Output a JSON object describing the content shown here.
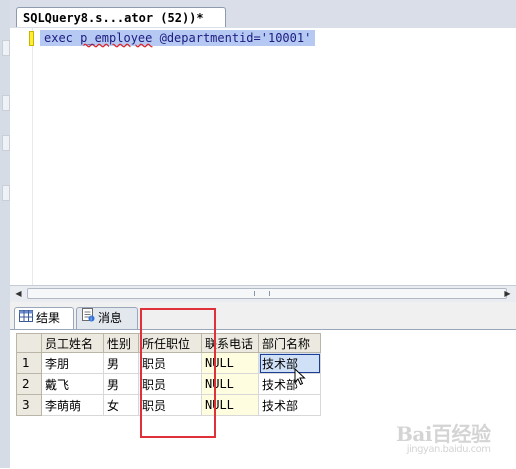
{
  "editor_tab": {
    "title": "SQLQuery8.s...ator (52))*"
  },
  "editor": {
    "code_prefix": "exec ",
    "code_proc": "p_employee",
    "code_suffix": " @departmentid='10001'"
  },
  "results_tabs": [
    {
      "label": "结果",
      "icon": "grid-icon"
    },
    {
      "label": "消息",
      "icon": "message-icon"
    }
  ],
  "grid": {
    "columns": [
      "员工姓名",
      "性别",
      "所任职位",
      "联系电话",
      "部门名称"
    ],
    "rows": [
      {
        "num": "1",
        "name": "李朋",
        "gender": "男",
        "position": "职员",
        "phone": "NULL",
        "dept": "技术部"
      },
      {
        "num": "2",
        "name": "戴飞",
        "gender": "男",
        "position": "职员",
        "phone": "NULL",
        "dept": "技术部"
      },
      {
        "num": "3",
        "name": "李萌萌",
        "gender": "女",
        "position": "职员",
        "phone": "NULL",
        "dept": "技术部"
      }
    ]
  },
  "watermark": {
    "text": "Bai百经验",
    "sub": "jingyan.baidu.com"
  },
  "colors": {
    "highlight": "#b6c9f2",
    "annotation_box": "#e0303a",
    "null_cell": "#fffde0"
  }
}
